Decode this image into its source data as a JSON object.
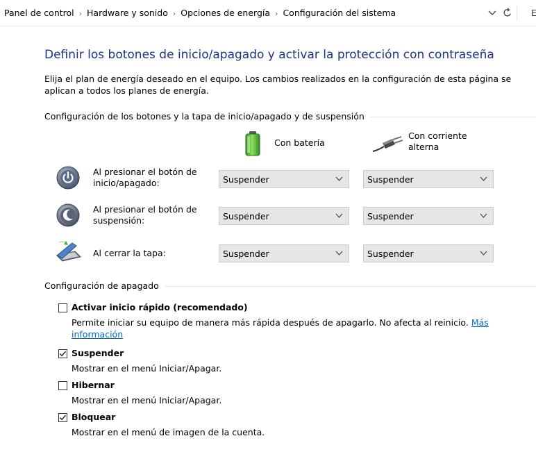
{
  "address_bar": {
    "breadcrumbs": [
      "Panel de control",
      "Hardware y sonido",
      "Opciones de energía",
      "Configuración del sistema"
    ],
    "separator": "›",
    "clipped_char": "E"
  },
  "page": {
    "title": "Definir los botones de inicio/apagado y activar la protección con contraseña",
    "description": "Elija el plan de energía deseado en el equipo. Los cambios realizados en la configuración de esta página se aplican a todos los planes de energía."
  },
  "buttons_section": {
    "header": "Configuración de los botones y la tapa de inicio/apagado y de suspensión",
    "columns": [
      "Con batería",
      "Con corriente alterna"
    ],
    "rows": [
      {
        "label": "Al presionar el botón de inicio/apagado:",
        "battery": "Suspender",
        "ac": "Suspender"
      },
      {
        "label": "Al presionar el botón de suspensión:",
        "battery": "Suspender",
        "ac": "Suspender"
      },
      {
        "label": "Al cerrar la tapa:",
        "battery": "Suspender",
        "ac": "Suspender"
      }
    ]
  },
  "shutdown_section": {
    "header": "Configuración de apagado",
    "options": [
      {
        "label": "Activar inicio rápido (recomendado)",
        "checked": false,
        "description": "Permite iniciar su equipo de manera más rápida después de apagarlo. No afecta al reinicio.",
        "link": "Más información"
      },
      {
        "label": "Suspender",
        "checked": true,
        "description": "Mostrar en el menú Iniciar/Apagar."
      },
      {
        "label": "Hibernar",
        "checked": false,
        "description": "Mostrar en el menú Iniciar/Apagar."
      },
      {
        "label": "Bloquear",
        "checked": true,
        "description": "Mostrar en el menú de imagen de la cuenta."
      }
    ]
  },
  "colors": {
    "title": "#1e3287",
    "link": "#0066cc",
    "select_bg": "#e6e6e6"
  }
}
